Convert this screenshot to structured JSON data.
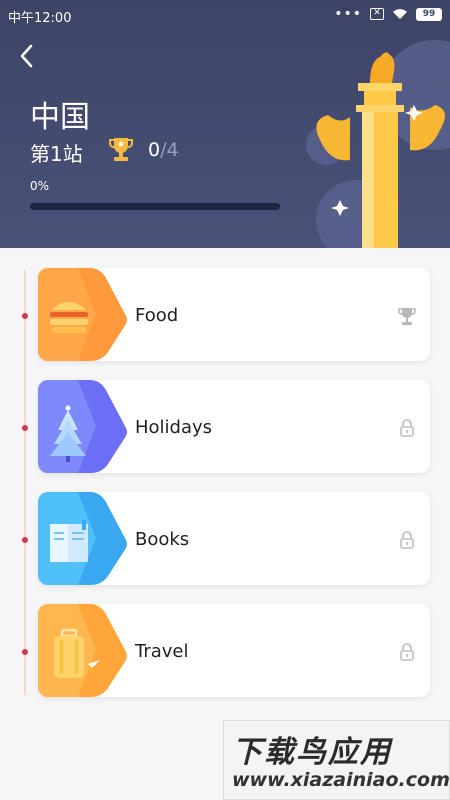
{
  "status_bar": {
    "time": "中午12:00",
    "signal_dots": "•••",
    "battery": "99"
  },
  "header": {
    "title": "中国",
    "station": "第1站",
    "score_done": "0",
    "score_separator": "/",
    "score_total": "4",
    "progress_text": "0%",
    "progress_value": 0
  },
  "topics": [
    {
      "label": "Food",
      "status": "trophy-icon"
    },
    {
      "label": "Holidays",
      "status": "lock-icon"
    },
    {
      "label": "Books",
      "status": "lock-icon"
    },
    {
      "label": "Travel",
      "status": "lock-icon"
    }
  ],
  "watermark": {
    "title": "下载鸟应用",
    "url": "www.xiazainiao.com"
  },
  "colors": {
    "header_bg": "#3d4466",
    "accent_gold": "#f5b942",
    "dot_red": "#d9364a",
    "food": "#ff9a3c",
    "holidays": "#6c6ff5",
    "books": "#3aa8f0",
    "travel": "#ffa63a"
  }
}
